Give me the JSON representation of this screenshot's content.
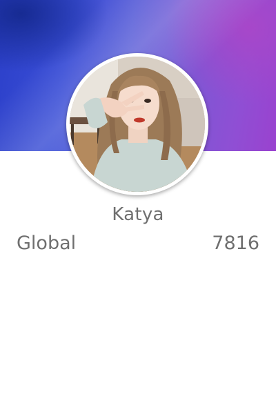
{
  "profile": {
    "name": "Katya",
    "avatar_icon": "user-photo",
    "scope_label": "Global",
    "score": "7816"
  },
  "colors": {
    "banner_start": "#2b3fc9",
    "banner_end": "#9a42cf",
    "text": "#6f6f6f"
  }
}
